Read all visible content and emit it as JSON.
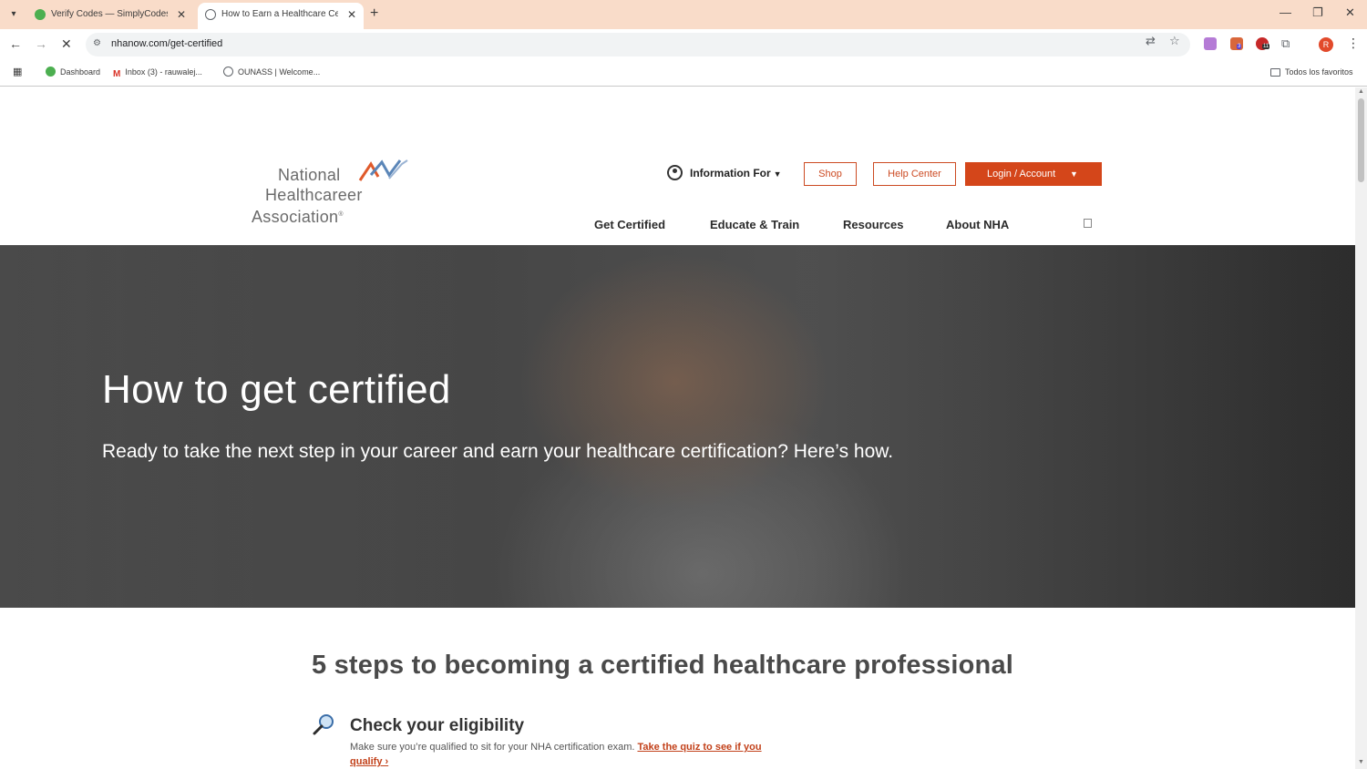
{
  "browser": {
    "tabs": [
      {
        "title": "Verify Codes — SimplyCodes",
        "active": false
      },
      {
        "title": "How to Earn a Healthcare Certif",
        "active": true
      }
    ],
    "address": "nhanow.com/get-certified",
    "bookmarks": [
      {
        "label": "Dashboard"
      },
      {
        "label": "Inbox (3) - rauwalej..."
      },
      {
        "label": "OUNASS | Welcome..."
      }
    ],
    "all_bookmarks": "Todos los favoritos",
    "profile_initial": "R",
    "ext_badges": [
      "3",
      "11"
    ]
  },
  "header": {
    "logo_lines": [
      "National",
      "Healthcareer",
      "Association"
    ],
    "logo_reg": "®",
    "info_for": "Information For",
    "shop": "Shop",
    "help_center": "Help Center",
    "login": "Login / Account",
    "nav": [
      "Get Certified",
      "Educate & Train",
      "Resources",
      "About NHA"
    ]
  },
  "hero": {
    "title": "How to get certified",
    "subtitle": "Ready to take the next step in your career and earn your healthcare certification? Here’s how."
  },
  "steps": {
    "title": "5 steps to becoming a certified healthcare professional",
    "items": [
      {
        "heading": "Check your eligibility",
        "description": "Make sure you’re qualified to sit for your NHA certification exam. ",
        "link": "Take the quiz to see if you qualify ›"
      }
    ]
  },
  "colors": {
    "accent": "#d4461a",
    "tabstrip": "#f9dcc9"
  }
}
